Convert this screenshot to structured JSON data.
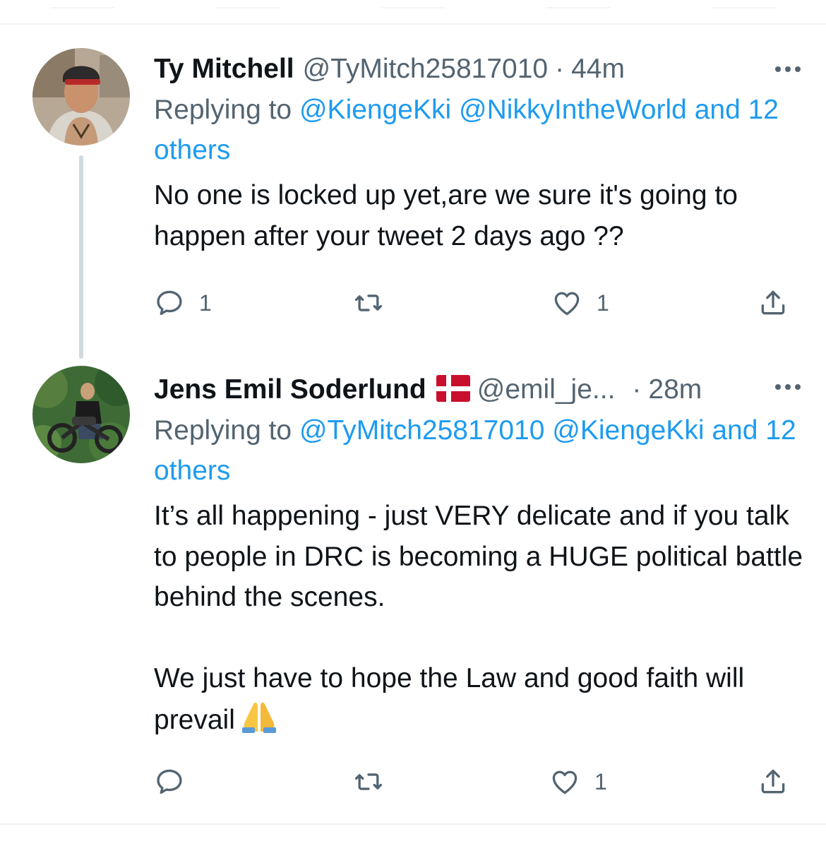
{
  "tweets": [
    {
      "name": "Ty Mitchell",
      "handle": "@TyMitch25817010",
      "separator": "·",
      "time": "44m",
      "replying_prefix": "Replying to",
      "replying_mentions": [
        "@KiengeKki",
        "@NikkyIntheWorld"
      ],
      "replying_suffix": "and 12 others",
      "text_lines": [
        "No one is locked up yet,are we sure it's going to happen after your tweet 2 days ago ??"
      ],
      "actions": {
        "reply_count": "1",
        "retweet_count": "",
        "like_count": "1"
      },
      "icons": {
        "more": "more-dots-icon",
        "reply": "reply-bubble-icon",
        "retweet": "retweet-icon",
        "like": "heart-icon",
        "share": "share-icon"
      }
    },
    {
      "name": "Jens Emil Soderlund",
      "flag": "denmark-flag",
      "handle": "@emil_je...",
      "separator": "·",
      "time": "28m",
      "replying_prefix": "Replying to",
      "replying_mentions": [
        "@TyMitch25817010",
        "@KiengeKki"
      ],
      "replying_suffix": "and 12 others",
      "paragraph_1": "It’s all happening - just VERY delicate and if you talk to people in DRC is becoming a HUGE political battle behind the scenes.",
      "paragraph_2": "We just have to hope the Law and good faith will prevail",
      "emoji": "folded-hands-emoji",
      "actions": {
        "reply_count": "",
        "retweet_count": "",
        "like_count": "1"
      },
      "icons": {
        "more": "more-dots-icon",
        "reply": "reply-bubble-icon",
        "retweet": "retweet-icon",
        "like": "heart-icon",
        "share": "share-icon"
      }
    }
  ],
  "colors": {
    "link": "#1d9bf0",
    "secondary_text": "#536471",
    "primary_text": "#0f1419",
    "thread_line": "#cfd9de"
  }
}
